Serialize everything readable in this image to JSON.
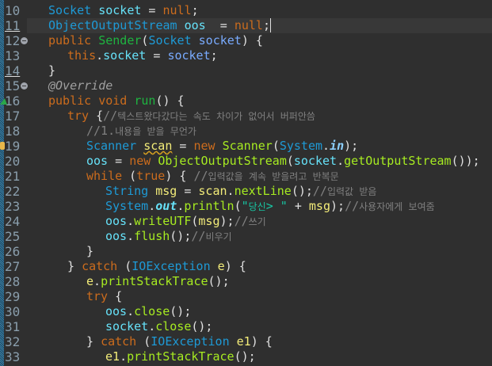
{
  "colors": {
    "background": "#2f2f2f",
    "current_line": "#383838",
    "keyword": "#cc6c1d",
    "type": "#1e9ad6",
    "field": "#66e1f8",
    "method": "#a7ec21",
    "comment": "#808080"
  },
  "lines": [
    {
      "n": "10",
      "indent": 0,
      "tokens": [
        [
          "type",
          "Socket"
        ],
        [
          "",
          ""
        ],
        [
          "field",
          " socket"
        ],
        [
          "",
          " = "
        ],
        [
          "kw",
          "null"
        ],
        [
          "",
          ";"
        ]
      ]
    },
    {
      "n": "11",
      "indent": 0,
      "current": true,
      "underline": true,
      "tokens": [
        [
          "type",
          "ObjectOutputStream"
        ],
        [
          "field",
          " oos"
        ],
        [
          "",
          "  = "
        ],
        [
          "kw",
          "null"
        ],
        [
          "caret",
          ";"
        ]
      ]
    },
    {
      "n": "12",
      "indent": 0,
      "fold": true,
      "tokens": [
        [
          "kw",
          "public "
        ],
        [
          "meth",
          "Sender"
        ],
        [
          "",
          "("
        ],
        [
          "type",
          "Socket"
        ],
        [
          "param",
          " socket"
        ],
        [
          "",
          ") {"
        ]
      ]
    },
    {
      "n": "13",
      "indent": 1,
      "tokens": [
        [
          "kw",
          "this"
        ],
        [
          "",
          "."
        ],
        [
          "field",
          "socket"
        ],
        [
          "",
          " = "
        ],
        [
          "param",
          "socket"
        ],
        [
          "",
          ";"
        ]
      ]
    },
    {
      "n": "14",
      "indent": 0,
      "underline": true,
      "tokens": [
        [
          "",
          "}"
        ]
      ]
    },
    {
      "n": "15",
      "indent": 0,
      "fold": true,
      "tokens": [
        [
          "ann",
          "@Override"
        ]
      ]
    },
    {
      "n": "16",
      "indent": 0,
      "marker": "override",
      "tokens": [
        [
          "kw",
          "public void "
        ],
        [
          "meth",
          "run"
        ],
        [
          "",
          "() {"
        ]
      ]
    },
    {
      "n": "17",
      "indent": 1,
      "tokens": [
        [
          "kw",
          "try"
        ],
        [
          "",
          " {"
        ],
        [
          "com",
          "//"
        ],
        [
          "com ko",
          "텍스트왔다갔다는 속도 차이가 없어서 버퍼안씀"
        ]
      ]
    },
    {
      "n": "18",
      "indent": 2,
      "tokens": [
        [
          "com",
          "//1."
        ],
        [
          "com ko",
          "내용을 받을 무언가"
        ]
      ]
    },
    {
      "n": "19",
      "indent": 2,
      "marker": "warning",
      "tokens": [
        [
          "type",
          "Scanner "
        ],
        [
          "local warnu",
          "scan"
        ],
        [
          "",
          " = "
        ],
        [
          "kw",
          "new "
        ],
        [
          "call",
          "Scanner"
        ],
        [
          "",
          "("
        ],
        [
          "type",
          "System"
        ],
        [
          "",
          "."
        ],
        [
          "sfield",
          "in"
        ],
        [
          "",
          ");"
        ]
      ]
    },
    {
      "n": "20",
      "indent": 2,
      "tokens": [
        [
          "field",
          "oos"
        ],
        [
          "",
          " = "
        ],
        [
          "kw",
          "new "
        ],
        [
          "call",
          "ObjectOutputStream"
        ],
        [
          "",
          "("
        ],
        [
          "field",
          "socket"
        ],
        [
          "",
          "."
        ],
        [
          "call",
          "getOutputStream"
        ],
        [
          "",
          "());"
        ]
      ]
    },
    {
      "n": "21",
      "indent": 2,
      "tokens": [
        [
          "kw",
          "while"
        ],
        [
          "",
          " ("
        ],
        [
          "kw",
          "true"
        ],
        [
          "",
          ") { "
        ],
        [
          "com",
          "//"
        ],
        [
          "com ko",
          "입력값을 계속 받을려고 반복문"
        ]
      ]
    },
    {
      "n": "22",
      "indent": 3,
      "tokens": [
        [
          "type",
          "String "
        ],
        [
          "local",
          "msg"
        ],
        [
          "",
          " = "
        ],
        [
          "local",
          "scan"
        ],
        [
          "",
          "."
        ],
        [
          "call",
          "nextLine"
        ],
        [
          "",
          "();"
        ],
        [
          "com",
          "//"
        ],
        [
          "com ko",
          "입력값 받음"
        ]
      ]
    },
    {
      "n": "23",
      "indent": 3,
      "tokens": [
        [
          "type",
          "System"
        ],
        [
          "",
          "."
        ],
        [
          "sfield2",
          "out"
        ],
        [
          "",
          "."
        ],
        [
          "call",
          "println"
        ],
        [
          "",
          "("
        ],
        [
          "str",
          "\""
        ],
        [
          "str ko",
          "당신"
        ],
        [
          "str",
          "> \""
        ],
        [
          "",
          " + "
        ],
        [
          "local",
          "msg"
        ],
        [
          "",
          ");"
        ],
        [
          "com",
          "//"
        ],
        [
          "com ko",
          "사용자에게 보여줌"
        ]
      ]
    },
    {
      "n": "24",
      "indent": 3,
      "tokens": [
        [
          "field",
          "oos"
        ],
        [
          "",
          "."
        ],
        [
          "call",
          "writeUTF"
        ],
        [
          "",
          "("
        ],
        [
          "local",
          "msg"
        ],
        [
          "",
          ");"
        ],
        [
          "com",
          "//"
        ],
        [
          "com ko",
          "쓰기"
        ]
      ]
    },
    {
      "n": "25",
      "indent": 3,
      "tokens": [
        [
          "field",
          "oos"
        ],
        [
          "",
          "."
        ],
        [
          "call",
          "flush"
        ],
        [
          "",
          "();"
        ],
        [
          "com",
          "//"
        ],
        [
          "com ko",
          "비우기"
        ]
      ]
    },
    {
      "n": "26",
      "indent": 2,
      "tokens": [
        [
          "",
          "}"
        ]
      ]
    },
    {
      "n": "27",
      "indent": 1,
      "tokens": [
        [
          "",
          "} "
        ],
        [
          "kw",
          "catch"
        ],
        [
          "",
          " ("
        ],
        [
          "type",
          "IOException"
        ],
        [
          "local",
          " e"
        ],
        [
          "",
          ") {"
        ]
      ]
    },
    {
      "n": "28",
      "indent": 2,
      "tokens": [
        [
          "local",
          "e"
        ],
        [
          "",
          "."
        ],
        [
          "call",
          "printStackTrace"
        ],
        [
          "",
          "();"
        ]
      ]
    },
    {
      "n": "29",
      "indent": 2,
      "tokens": [
        [
          "kw",
          "try"
        ],
        [
          "",
          " {"
        ]
      ]
    },
    {
      "n": "30",
      "indent": 3,
      "tokens": [
        [
          "field",
          "oos"
        ],
        [
          "",
          "."
        ],
        [
          "call",
          "close"
        ],
        [
          "",
          "();"
        ]
      ]
    },
    {
      "n": "31",
      "indent": 3,
      "tokens": [
        [
          "field",
          "socket"
        ],
        [
          "",
          "."
        ],
        [
          "call",
          "close"
        ],
        [
          "",
          "();"
        ]
      ]
    },
    {
      "n": "32",
      "indent": 2,
      "tokens": [
        [
          "",
          "} "
        ],
        [
          "kw",
          "catch"
        ],
        [
          "",
          " ("
        ],
        [
          "type",
          "IOException"
        ],
        [
          "local",
          " e1"
        ],
        [
          "",
          ") {"
        ]
      ]
    },
    {
      "n": "33",
      "indent": 3,
      "tokens": [
        [
          "local",
          "e1"
        ],
        [
          "",
          "."
        ],
        [
          "call",
          "printStackTrace"
        ],
        [
          "",
          "();"
        ]
      ]
    }
  ]
}
